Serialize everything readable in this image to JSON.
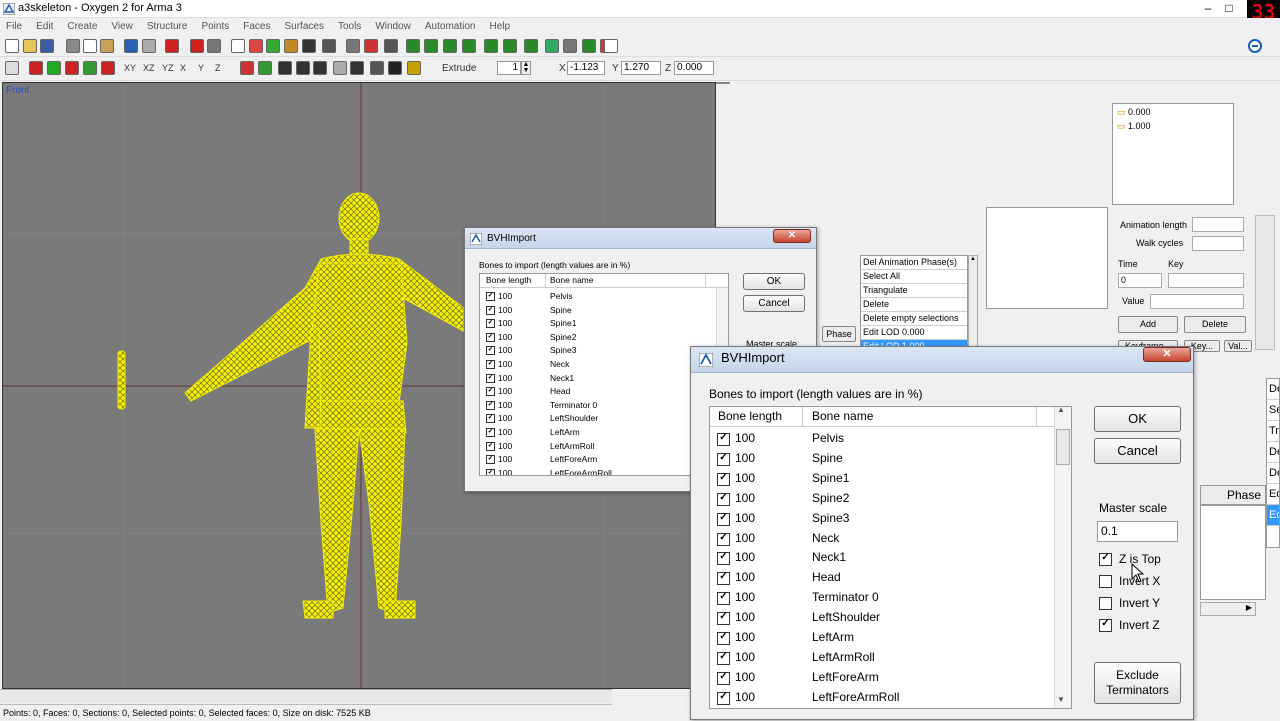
{
  "window": {
    "title": "a3skeleton - Oxygen 2 for Arma 3"
  },
  "overlay_counter": "33",
  "menu": [
    "File",
    "Edit",
    "Create",
    "View",
    "Structure",
    "Points",
    "Faces",
    "Surfaces",
    "Tools",
    "Window",
    "Automation",
    "Help"
  ],
  "toolbar2": {
    "axes": [
      "XY",
      "XZ",
      "YZ",
      "X",
      "Y",
      "Z"
    ],
    "extrude_label": "Extrude",
    "extrude_value": "1",
    "x_label": "X",
    "x_value": "-1.123",
    "y_label": "Y",
    "y_value": "1.270",
    "z_label": "Z",
    "z_value": "0.000"
  },
  "viewport": {
    "label": "Front"
  },
  "status": "Points: 0, Faces: 0, Sections: 0, Selected points: 0, Selected faces: 0, Size on disk: 7525 KB",
  "lod_list": [
    "0.000",
    "1.000"
  ],
  "anim_panel": {
    "length_label": "Animation length",
    "walk_label": "Walk cycles",
    "time_label": "Time",
    "key_label": "Key",
    "time_value": "0",
    "value_label": "Value",
    "add_label": "Add",
    "delete_label": "Delete",
    "keyframe_cut": "Keyframe...",
    "key_cut": "Key...",
    "val_cut": "Val..."
  },
  "context_menu": [
    "Del Animation Phase(s)",
    "Select All",
    "Triangulate",
    "Delete",
    "Delete empty selections",
    "Edit LOD   0.000",
    "Edit LOD   1.000"
  ],
  "phase_label": "Phase",
  "right_edge_list": [
    "De",
    "Se",
    "Tr",
    "De",
    "De",
    "Ed",
    "Ed"
  ],
  "phase_label_big": "Phase",
  "dialog": {
    "title": "BVHImport",
    "caption": "Bones to import (length values are in %)",
    "col_length": "Bone length",
    "col_name": "Bone name",
    "ok": "OK",
    "cancel": "Cancel",
    "master_scale_label": "Master scale",
    "master_scale_value": "0.1",
    "z_is_top": "Z is Top",
    "invert_x": "Invert X",
    "invert_y": "Invert Y",
    "invert_z": "Invert Z",
    "exclude_terminators": "Exclude Terminators",
    "checks": {
      "z_is_top": true,
      "invert_x": false,
      "invert_y": false,
      "invert_z": true
    },
    "bones": [
      {
        "length": "100",
        "name": "Pelvis",
        "checked": true
      },
      {
        "length": "100",
        "name": "Spine",
        "checked": true
      },
      {
        "length": "100",
        "name": "Spine1",
        "checked": true
      },
      {
        "length": "100",
        "name": "Spine2",
        "checked": true
      },
      {
        "length": "100",
        "name": "Spine3",
        "checked": true
      },
      {
        "length": "100",
        "name": "Neck",
        "checked": true
      },
      {
        "length": "100",
        "name": "Neck1",
        "checked": true
      },
      {
        "length": "100",
        "name": "Head",
        "checked": true
      },
      {
        "length": "100",
        "name": "Terminator 0",
        "checked": true
      },
      {
        "length": "100",
        "name": "LeftShoulder",
        "checked": true
      },
      {
        "length": "100",
        "name": "LeftArm",
        "checked": true
      },
      {
        "length": "100",
        "name": "LeftArmRoll",
        "checked": true
      },
      {
        "length": "100",
        "name": "LeftForeArm",
        "checked": true
      },
      {
        "length": "100",
        "name": "LeftForeArmRoll",
        "checked": true
      }
    ]
  },
  "colors": {
    "wireframe": "#f5f000",
    "viewport_bg": "#7a7a7a",
    "selection": "#3399ff",
    "front_label": "#1f4fd9"
  }
}
